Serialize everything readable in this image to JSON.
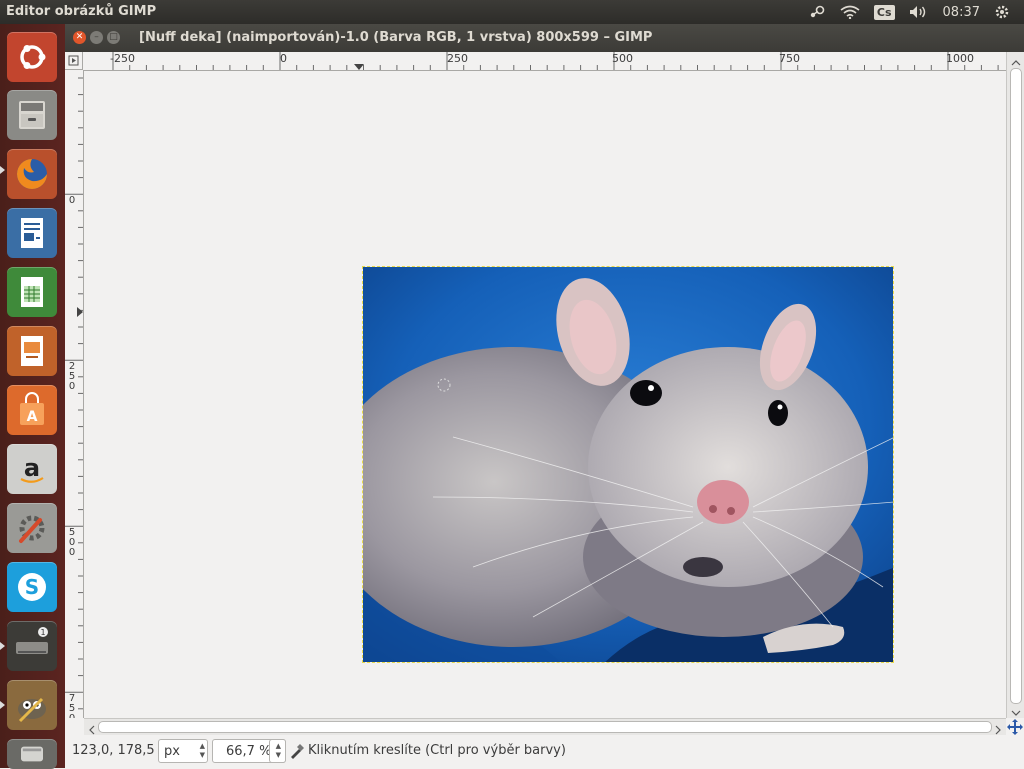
{
  "topbar": {
    "app_title": "Editor obrázků GIMP",
    "keyboard_layout": "Cs",
    "clock": "08:37"
  },
  "window": {
    "title": "[Nuff deka] (naimportován)-1.0 (Barva RGB, 1 vrstva) 800x599 – GIMP"
  },
  "launcher": {
    "items": [
      "ubuntu-dash",
      "files",
      "firefox",
      "libreoffice-writer",
      "libreoffice-calc",
      "libreoffice-impress",
      "ubuntu-software-center",
      "amazon",
      "system-settings",
      "skype",
      "removable-drive",
      "gimp",
      "trash"
    ],
    "drive_badge": "1"
  },
  "rulers": {
    "horizontal": [
      "-250",
      "0",
      "250",
      "500",
      "750",
      "1000"
    ],
    "vertical": [
      "0",
      "250",
      "500",
      "750"
    ]
  },
  "canvas": {
    "image_description_icon": "rat-photo"
  },
  "statusbar": {
    "coordinates": "123,0, 178,5",
    "unit": "px",
    "zoom": "66,7 %",
    "message": "Kliknutím kreslíte (Ctrl pro výběr barvy)"
  },
  "colors": {
    "launcher_bg": "#5b2420",
    "panel_bg": "#3c3b37",
    "close_button": "#e0562b",
    "canvas_bg": "#f2f1f0"
  }
}
